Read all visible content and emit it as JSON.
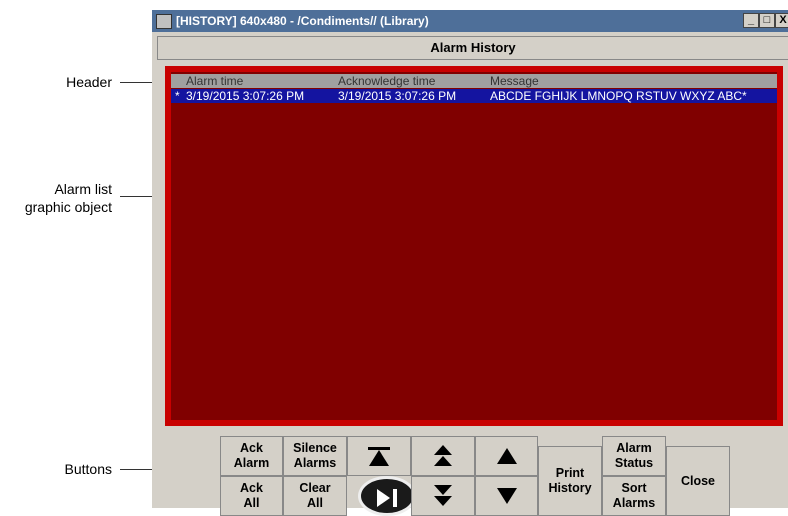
{
  "annotations": {
    "header": "Header",
    "alarm_list_line1": "Alarm list",
    "alarm_list_line2": "graphic object",
    "buttons": "Buttons"
  },
  "window": {
    "title": "[HISTORY] 640x480 - /Condiments// (Library)",
    "minimize_glyph": "_",
    "maximize_glyph": "□",
    "close_glyph": "X"
  },
  "screen_header": "Alarm History",
  "alarm_list": {
    "columns": [
      "Alarm time",
      "Acknowledge time",
      "Message"
    ],
    "rows": [
      {
        "marker": "*",
        "alarm_time": "3/19/2015 3:07:26 PM",
        "ack_time": "3/19/2015 3:07:26 PM",
        "message": "ABCDE FGHIJK LMNOPQ RSTUV WXYZ ABC*"
      }
    ]
  },
  "buttons": {
    "ack_alarm": [
      "Ack",
      "Alarm"
    ],
    "ack_all": [
      "Ack",
      "All"
    ],
    "silence_alarms": [
      "Silence",
      "Alarms"
    ],
    "clear_all": [
      "Clear",
      "All"
    ],
    "print_history": [
      "Print",
      "History"
    ],
    "alarm_status": [
      "Alarm",
      "Status"
    ],
    "sort_alarms": [
      "Sort",
      "Alarms"
    ],
    "close": "Close"
  },
  "colors": {
    "list_background": "#800000",
    "list_frame": "#c80000",
    "selected_row": "#1414a0",
    "title_bar": "#4e6f99"
  }
}
